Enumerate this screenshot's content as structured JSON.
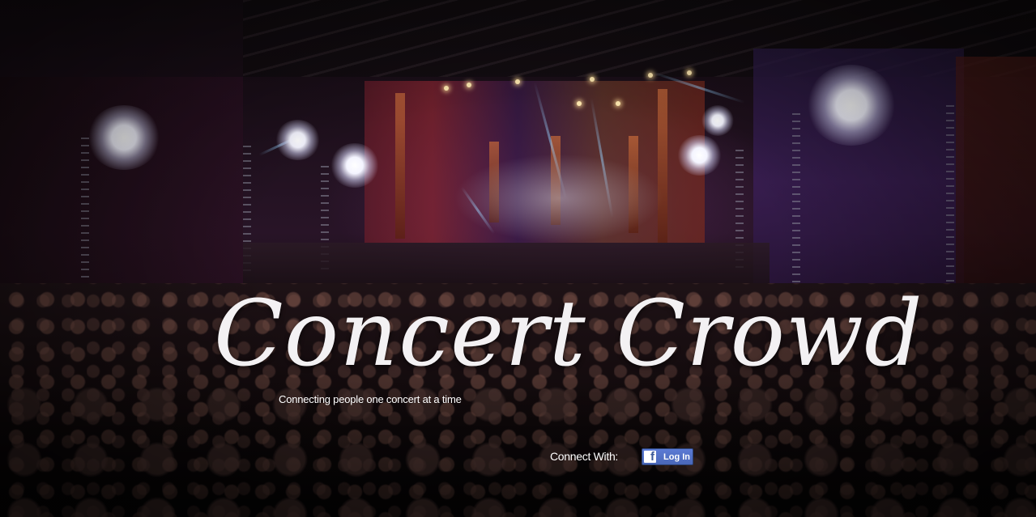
{
  "hero": {
    "title": "Concert Crowd",
    "tagline": "Connecting people one concert at a time"
  },
  "auth": {
    "connect_label": "Connect With:",
    "login_label": "Log In",
    "login_icon_glyph": "f",
    "icon": "facebook-icon",
    "brand_color": "#4a68b8"
  }
}
